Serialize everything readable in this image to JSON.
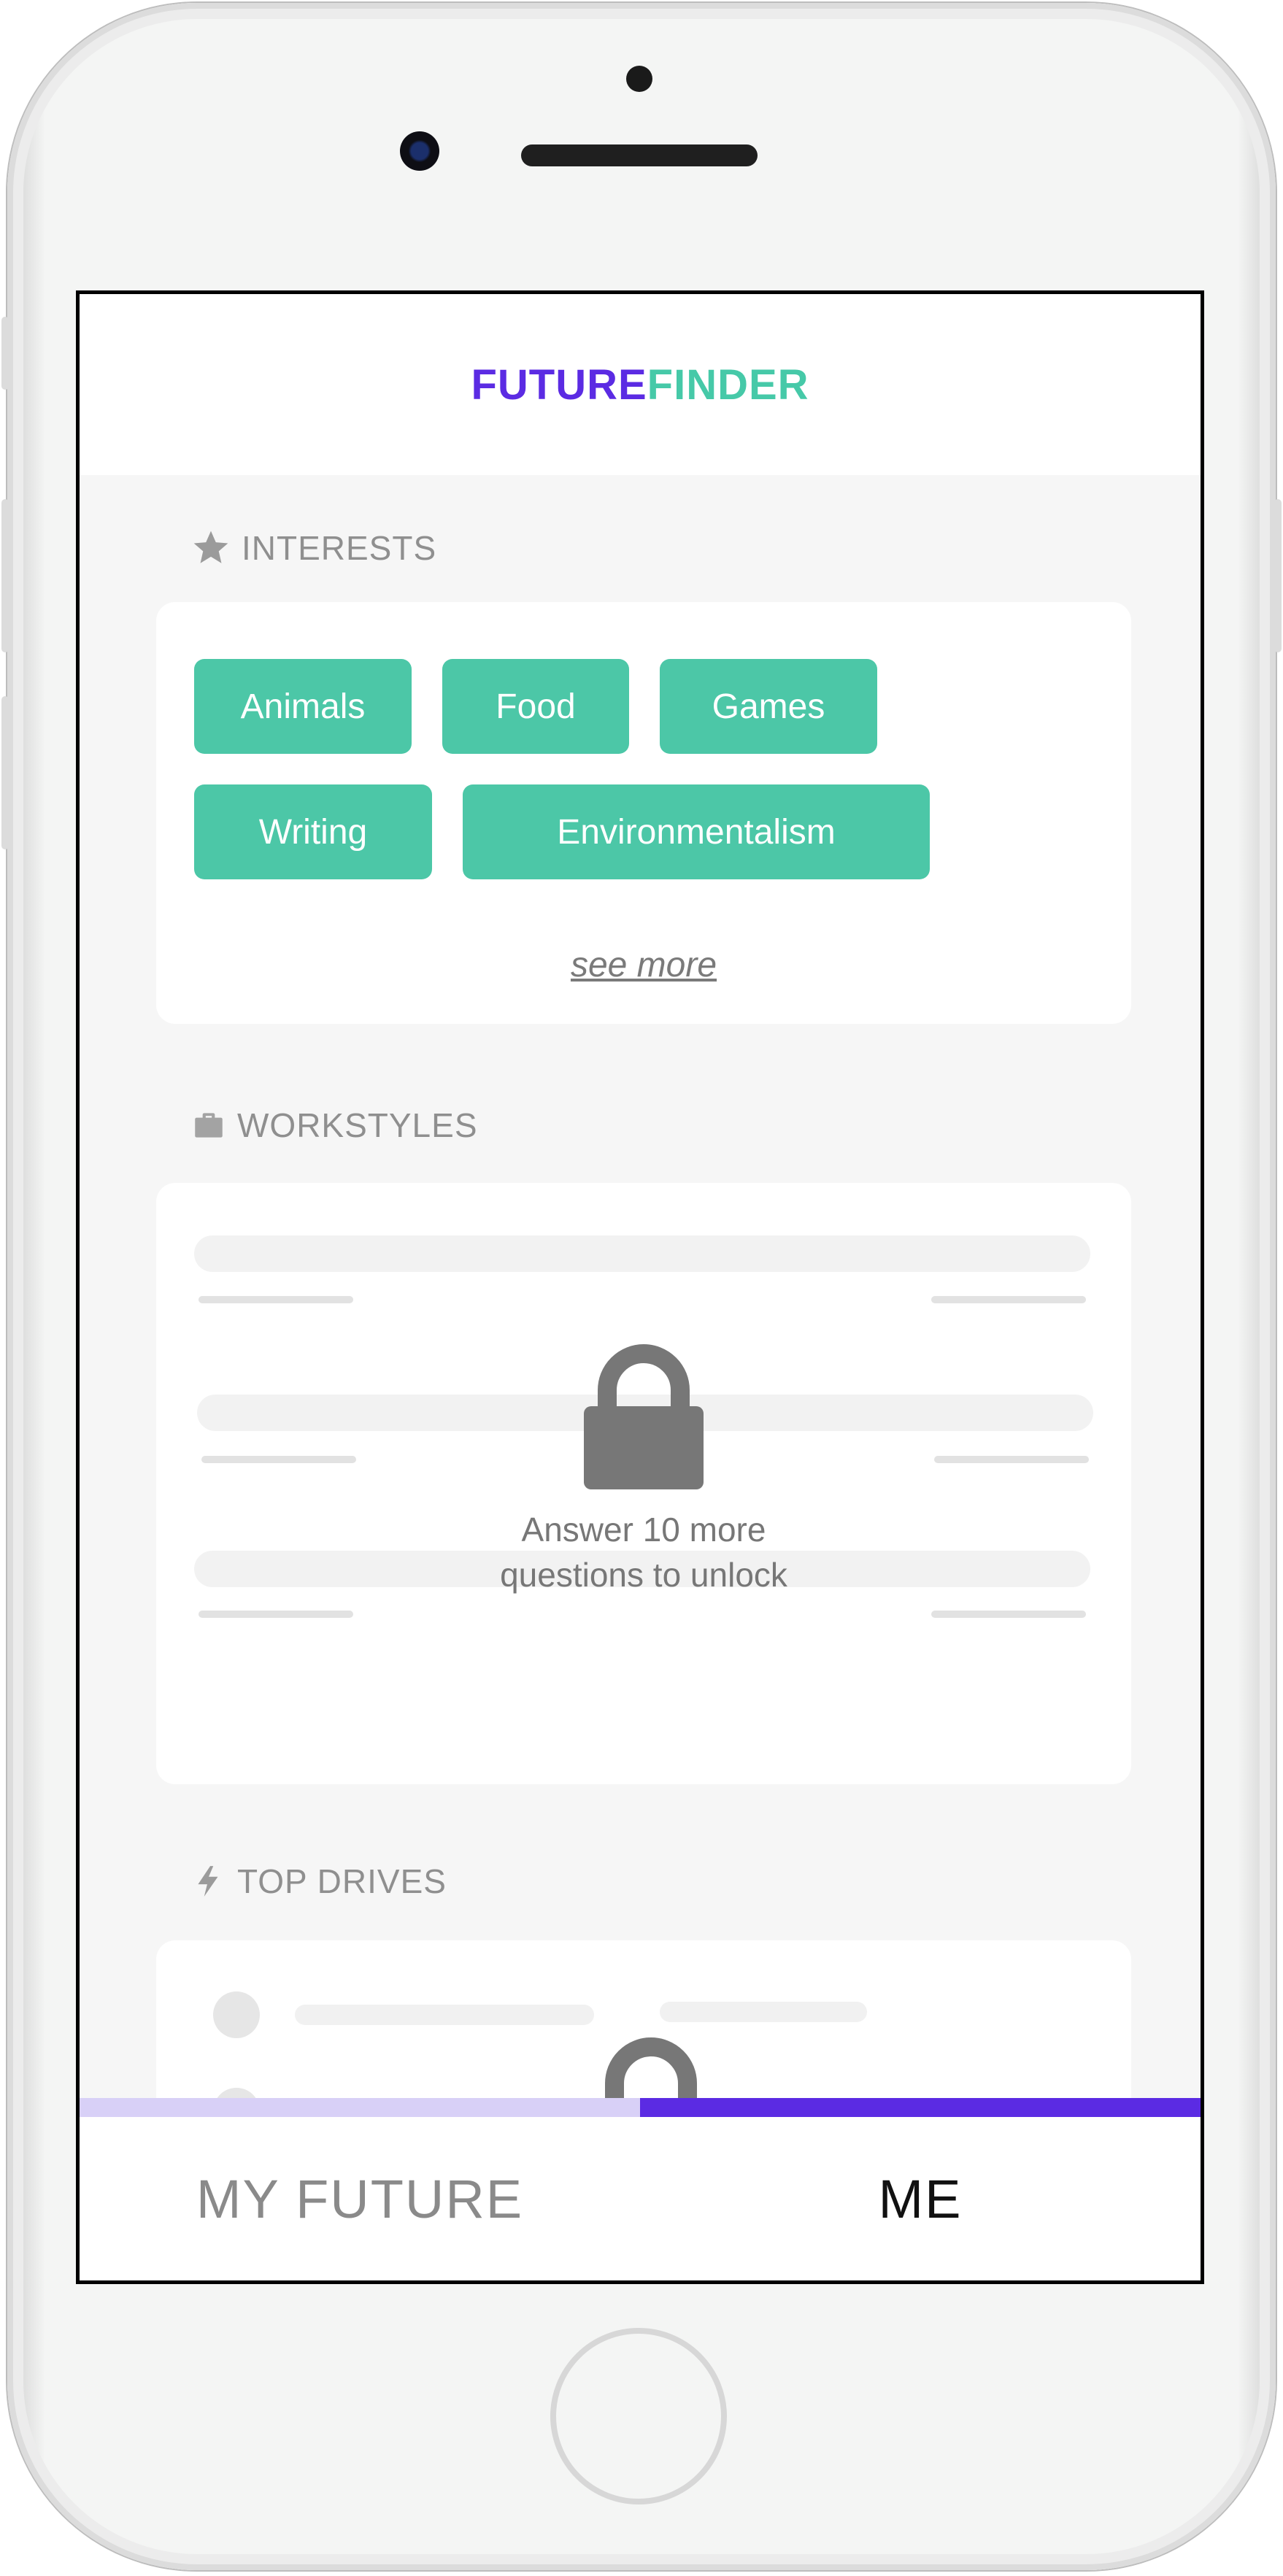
{
  "app": {
    "logo_future": "FUTURE",
    "logo_finder": "FINDER"
  },
  "interests": {
    "title": "INTERESTS",
    "chips": [
      "Animals",
      "Food",
      "Games",
      "Writing",
      "Environmentalism"
    ],
    "see_more": "see more"
  },
  "workstyles": {
    "title": "WORKSTYLES",
    "lock_line1": "Answer 10 more",
    "lock_line2": "questions to unlock"
  },
  "top_drives": {
    "title": "TOP DRIVES"
  },
  "tabs": {
    "left": "MY FUTURE",
    "right": "ME",
    "active": "ME"
  },
  "colors": {
    "brand_purple": "#5b2be3",
    "brand_teal": "#46c9a8",
    "chip": "#4cc7a7"
  },
  "icons": {
    "interests": "star-icon",
    "workstyles": "briefcase-icon",
    "top_drives": "lightning-icon",
    "locked": "lock-icon"
  }
}
